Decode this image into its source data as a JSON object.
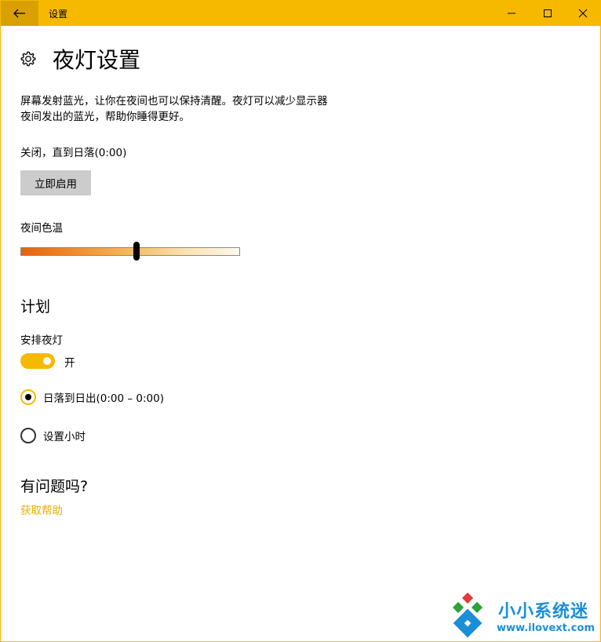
{
  "window": {
    "title": "设置",
    "controls": {
      "minimize_icon": "minimize-icon",
      "maximize_icon": "maximize-icon",
      "close_icon": "close-icon"
    },
    "accent_color": "#f7b900"
  },
  "page": {
    "title": "夜灯设置",
    "icon": "gear-icon",
    "description_line1": "屏幕发射蓝光，让你在夜间也可以保持清醒。夜灯可以减少显示器",
    "description_line2": "夜间发出的蓝光，帮助你睡得更好。",
    "status": "关闭，直到日落(0:00)",
    "enable_button": "立即启用"
  },
  "color_temperature": {
    "label": "夜间色温",
    "value_fraction": 0.53
  },
  "schedule": {
    "section_title": "计划",
    "toggle_label": "安排夜灯",
    "toggle_state_text": "开",
    "toggle_on": true,
    "options": [
      {
        "label": "日落到日出(0:00 – 0:00)",
        "selected": true
      },
      {
        "label": "设置小时",
        "selected": false
      }
    ]
  },
  "help": {
    "title": "有问题吗?",
    "link": "获取帮助"
  },
  "watermark": {
    "name": "小小系统迷",
    "url": "www.ilovext.com"
  }
}
